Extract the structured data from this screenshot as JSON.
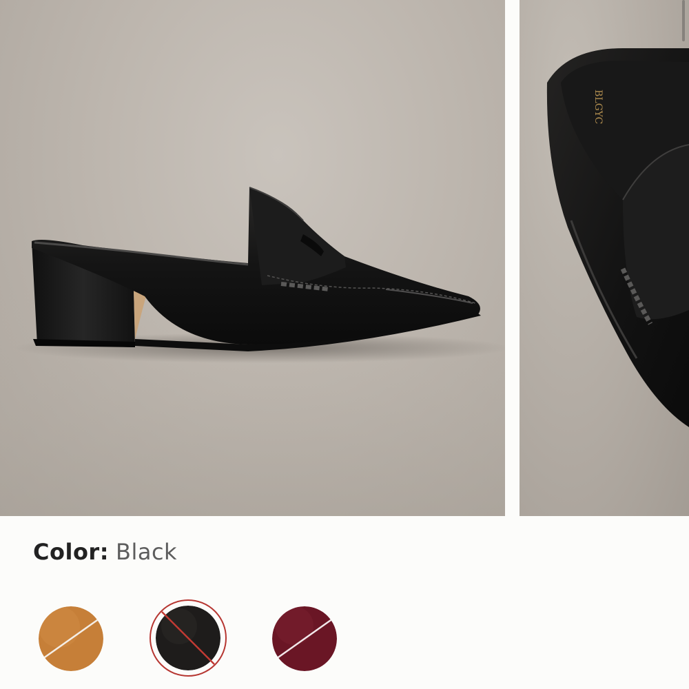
{
  "product_gallery": {
    "slides": [
      {
        "name": "side view",
        "brand_mark": ""
      },
      {
        "name": "top view close-up",
        "brand_mark": "BLGYC"
      }
    ]
  },
  "color_selector": {
    "label": "Color:",
    "selected": "Black",
    "swatches": [
      {
        "name": "tan",
        "color": "#c67f38",
        "unavailable": true,
        "selected": false
      },
      {
        "name": "black",
        "color": "#1e1c1b",
        "unavailable": true,
        "selected": true
      },
      {
        "name": "wine",
        "color": "#6a1625",
        "unavailable": true,
        "selected": false
      }
    ]
  },
  "colors": {
    "page_background": "#fcfcfa",
    "selected_ring": "#b63631",
    "label_text": "#222222",
    "value_text": "#5d5d5d"
  }
}
